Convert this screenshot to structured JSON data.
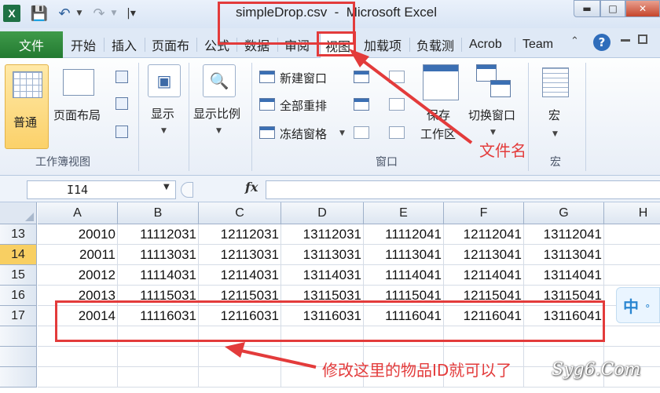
{
  "window": {
    "title": "simpleDrop.csv  -  Microsoft Excel",
    "app_icon": "X",
    "quick_access": {
      "save_icon": "save-icon",
      "undo_icon": "undo-icon",
      "redo_icon": "redo-icon"
    }
  },
  "ribbon_tabs": [
    "文件",
    "开始",
    "插入",
    "页面布",
    "公式",
    "数据",
    "审阅",
    "视图",
    "加载项",
    "负载测",
    "Acrob",
    "Team"
  ],
  "ribbon": {
    "workbook_views": {
      "normal": "普通",
      "page_layout": "页面布局",
      "group_label": "工作簿视图"
    },
    "show": "显示",
    "zoom": "显示比例",
    "window": {
      "new_window": "新建窗口",
      "arrange_all": "全部重排",
      "freeze_panes": "冻结窗格",
      "save_workspace_1": "保存",
      "save_workspace_2": "工作区",
      "switch_windows": "切换窗口",
      "group_label": "窗口"
    },
    "macros": {
      "label": "宏",
      "group_label": "宏"
    }
  },
  "formula_bar": {
    "name_box": "I14",
    "fx": "fx",
    "formula": ""
  },
  "sheet": {
    "columns": [
      "A",
      "B",
      "C",
      "D",
      "E",
      "F",
      "G",
      "H"
    ],
    "rows": [
      {
        "num": "13",
        "cells": [
          "20010",
          "11112031",
          "12112031",
          "13112031",
          "11112041",
          "12112041",
          "13112041",
          ""
        ]
      },
      {
        "num": "14",
        "cells": [
          "20011",
          "11113031",
          "12113031",
          "13113031",
          "11113041",
          "12113041",
          "13113041",
          ""
        ]
      },
      {
        "num": "15",
        "cells": [
          "20012",
          "11114031",
          "12114031",
          "13114031",
          "11114041",
          "12114041",
          "13114041",
          ""
        ]
      },
      {
        "num": "16",
        "cells": [
          "20013",
          "11115031",
          "12115031",
          "13115031",
          "11115041",
          "12115041",
          "13115041",
          ""
        ]
      },
      {
        "num": "17",
        "cells": [
          "20014",
          "11116031",
          "12116031",
          "13116031",
          "11116041",
          "12116041",
          "13116041",
          ""
        ]
      },
      {
        "num": "",
        "cells": [
          "",
          "",
          "",
          "",
          "",
          "",
          "",
          ""
        ]
      },
      {
        "num": "",
        "cells": [
          "",
          "",
          "",
          "",
          "",
          "",
          "",
          ""
        ]
      },
      {
        "num": "",
        "cells": [
          "",
          "",
          "",
          "",
          "",
          "",
          "",
          ""
        ]
      }
    ],
    "selected_row": "14"
  },
  "annotations": {
    "file_name_label": "文件名",
    "edit_hint": "修改这里的物品ID就可以了",
    "color": "#e33b3b"
  },
  "ime": {
    "label": "中",
    "dot": "°"
  },
  "watermark": "Syg6.Com"
}
